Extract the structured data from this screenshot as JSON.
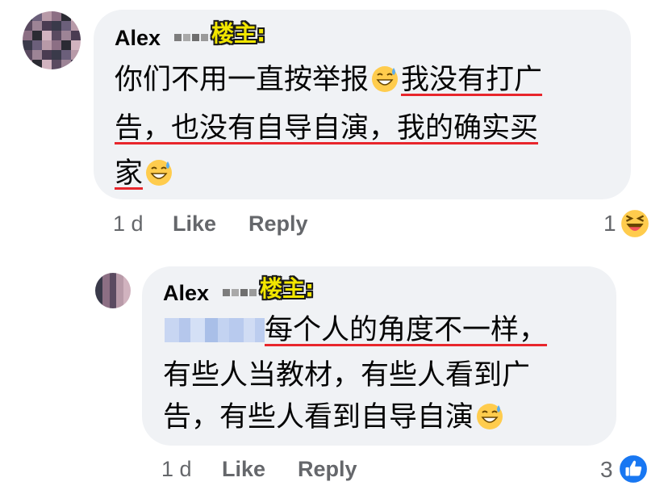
{
  "colors": {
    "bubble_bg": "#f0f2f5",
    "underline": "#e8262c",
    "badge_yellow": "#f2e600",
    "meta_gray": "#65676b",
    "like_blue": "#1877f2"
  },
  "comment1": {
    "author": "Alex",
    "badge": "楼主:",
    "line1_plain": "你们不用一直按举报",
    "line1_emoji": "grinning-sweat-emoji",
    "line1_underlined": "我没有打广",
    "line2": "告，也没有自导自演，我的确实买",
    "line3": "家",
    "line3_emoji": "grinning-sweat-emoji",
    "time": "1 d",
    "like": "Like",
    "reply": "Reply",
    "reaction_count": "1",
    "reaction_icon": "laughing-emoji"
  },
  "comment2": {
    "author": "Alex",
    "badge": "楼主:",
    "mention_underlined": "每个人的角度不一样，",
    "line2": "有些人当教材，有些人看到广",
    "line3": "告，有些人看到自导自演",
    "line3_emoji": "grinning-sweat-emoji",
    "time": "1 d",
    "like": "Like",
    "reply": "Reply",
    "reaction_count": "3",
    "reaction_icon": "like-thumb-icon"
  }
}
